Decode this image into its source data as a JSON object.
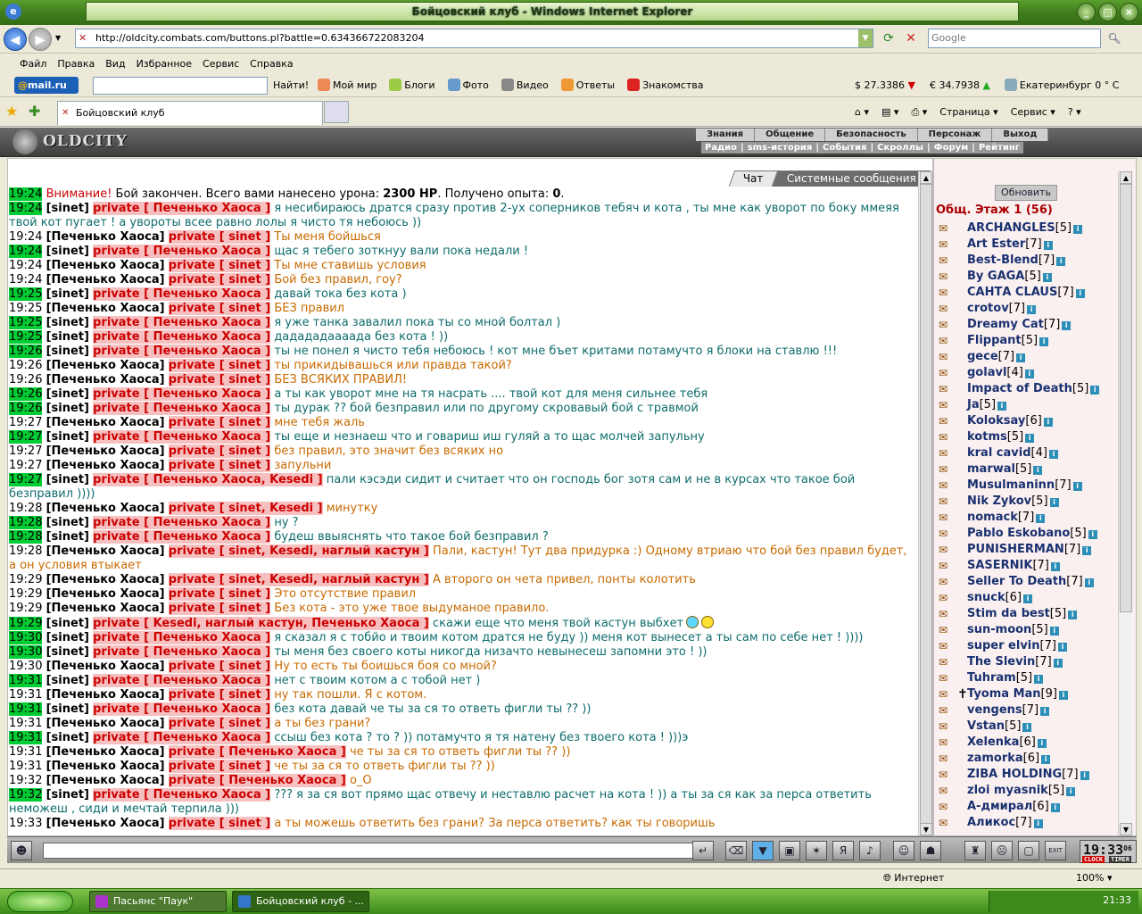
{
  "window": {
    "title": "Бойцовский клуб - Windows Internet Explorer"
  },
  "address": {
    "url": "http://oldcity.combats.com/buttons.pl?battle=0.634366722083204",
    "search_placeholder": "Google"
  },
  "menu": [
    "Файл",
    "Правка",
    "Вид",
    "Избранное",
    "Сервис",
    "Справка"
  ],
  "mailbar": {
    "logo": "mail.ru",
    "find": "Найти!",
    "links": [
      "Мой мир",
      "Блоги",
      "Фото",
      "Видео",
      "Ответы",
      "Знакомства"
    ],
    "usd": "$ 27.3386",
    "eur": "€ 34.7938",
    "weather": "Екатеринбург 0 ° C"
  },
  "tab": {
    "label": "Бойцовский клуб"
  },
  "ietools": {
    "page": "Страница",
    "service": "Сервис"
  },
  "game": {
    "logo": "OLDCITY",
    "topnav": [
      "Знания",
      "Общение",
      "Безопасность",
      "Персонаж",
      "Выход"
    ],
    "subnav": [
      "Радио",
      "sms-история",
      "События",
      "Скроллы",
      "Форум",
      "Рейтинг"
    ]
  },
  "chat": {
    "tabs": {
      "chat": "Чат",
      "system": "Системные сообщения"
    },
    "lines": [
      {
        "t": "19:24",
        "h": true,
        "a": "",
        "p": "",
        "m": "",
        "sys": true,
        "pre": "Внимание!",
        "body1": " Бой закончен. Всего вами нанесено урона: ",
        "b1": "2300 HP",
        "body2": ". Получено опыта: ",
        "b2": "0",
        "body3": "."
      },
      {
        "t": "19:24",
        "h": true,
        "a": "[sinet]",
        "p": "private [ Печенько Хаоса ]",
        "m": "я несибираюсь дратся сразу против 2-ух соперников тебяч и кота , ты мне как уворот по боку ммеяя твой кот пугает ! а увороты всее равно лолы я чисто тя небоюсь ))",
        "c": "teal"
      },
      {
        "t": "19:24",
        "h": false,
        "a": "[Печенько Хаоса]",
        "p": "private [ sinet ]",
        "m": "Ты меня бойшься",
        "c": "orange"
      },
      {
        "t": "19:24",
        "h": true,
        "a": "[sinet]",
        "p": "private [ Печенько Хаоса ]",
        "m": "щас я тебего зоткнуу вали пока недали !",
        "c": "teal"
      },
      {
        "t": "19:24",
        "h": false,
        "a": "[Печенько Хаоса]",
        "p": "private [ sinet ]",
        "m": "Ты мне ставишь условия",
        "c": "orange"
      },
      {
        "t": "19:24",
        "h": false,
        "a": "[Печенько Хаоса]",
        "p": "private [ sinet ]",
        "m": "Бой без правил, гоу?",
        "c": "orange"
      },
      {
        "t": "19:25",
        "h": true,
        "a": "[sinet]",
        "p": "private [ Печенько Хаоса ]",
        "m": "давай тока без кота )",
        "c": "teal"
      },
      {
        "t": "19:25",
        "h": false,
        "a": "[Печенько Хаоса]",
        "p": "private [ sinet ]",
        "m": "БЕЗ правил",
        "c": "orange"
      },
      {
        "t": "19:25",
        "h": true,
        "a": "[sinet]",
        "p": "private [ Печенько Хаоса ]",
        "m": "я уже танка завалил пока ты со мной болтал )",
        "c": "teal"
      },
      {
        "t": "19:25",
        "h": true,
        "a": "[sinet]",
        "p": "private [ Печенько Хаоса ]",
        "m": "дадададаааада без кота ! ))",
        "c": "teal"
      },
      {
        "t": "19:26",
        "h": true,
        "a": "[sinet]",
        "p": "private [ Печенько Хаоса ]",
        "m": "ты не понел я чисто тебя небоюсь ! кот мне бъет критами потамучто я блоки на ставлю !!!",
        "c": "teal"
      },
      {
        "t": "19:26",
        "h": false,
        "a": "[Печенько Хаоса]",
        "p": "private [ sinet ]",
        "m": "ты прикидывашься или правда такой?",
        "c": "orange"
      },
      {
        "t": "19:26",
        "h": false,
        "a": "[Печенько Хаоса]",
        "p": "private [ sinet ]",
        "m": "БЕЗ ВСЯКИХ ПРАВИЛ!",
        "c": "orange"
      },
      {
        "t": "19:26",
        "h": true,
        "a": "[sinet]",
        "p": "private [ Печенько Хаоса ]",
        "m": "а ты как уворот мне на тя насрать .... твой кот для меня сильнее тебя",
        "c": "teal"
      },
      {
        "t": "19:26",
        "h": true,
        "a": "[sinet]",
        "p": "private [ Печенько Хаоса ]",
        "m": "ты дурак ?? бой безправил или по другому скровавый бой с травмой",
        "c": "teal"
      },
      {
        "t": "19:27",
        "h": false,
        "a": "[Печенько Хаоса]",
        "p": "private [ sinet ]",
        "m": "мне тебя жаль",
        "c": "orange"
      },
      {
        "t": "19:27",
        "h": true,
        "a": "[sinet]",
        "p": "private [ Печенько Хаоса ]",
        "m": "ты еще и незнаеш что и говариш иш гуляй а то щас молчей запульну",
        "c": "teal"
      },
      {
        "t": "19:27",
        "h": false,
        "a": "[Печенько Хаоса]",
        "p": "private [ sinet ]",
        "m": "без правил, это значит без всяких но",
        "c": "orange"
      },
      {
        "t": "19:27",
        "h": false,
        "a": "[Печенько Хаоса]",
        "p": "private [ sinet ]",
        "m": "запульни",
        "c": "orange"
      },
      {
        "t": "19:27",
        "h": true,
        "a": "[sinet]",
        "p": "private [ Печенько Хаоса, Kesedi ]",
        "m": "пали кэсэди сидит и считает что он господь бог зотя сам и не в курсах что такое бой безправил ))))",
        "c": "teal"
      },
      {
        "t": "19:28",
        "h": false,
        "a": "[Печенько Хаоса]",
        "p": "private [ sinet, Kesedi ]",
        "m": "минутку",
        "c": "orange"
      },
      {
        "t": "19:28",
        "h": true,
        "a": "[sinet]",
        "p": "private [ Печенько Хаоса ]",
        "m": "ну ?",
        "c": "teal"
      },
      {
        "t": "19:28",
        "h": true,
        "a": "[sinet]",
        "p": "private [ Печенько Хаоса ]",
        "m": "будеш ввыяснять что такое бой безправил ?",
        "c": "teal"
      },
      {
        "t": "19:28",
        "h": false,
        "a": "[Печенько Хаоса]",
        "p": "private [ sinet, Kesedi, наглый кастун ]",
        "m": "Пали, кастун! Тут два придурка :) Одному втриаю что бой без правил будет, а он условия втыкает",
        "c": "orange"
      },
      {
        "t": "19:29",
        "h": false,
        "a": "[Печенько Хаоса]",
        "p": "private [ sinet, Kesedi, наглый кастун ]",
        "m": "А второго он чета привел, понты колотить",
        "c": "orange"
      },
      {
        "t": "19:29",
        "h": false,
        "a": "[Печенько Хаоса]",
        "p": "private [ sinet ]",
        "m": "Это отсутствие правил",
        "c": "orange"
      },
      {
        "t": "19:29",
        "h": false,
        "a": "[Печенько Хаоса]",
        "p": "private [ sinet ]",
        "m": "Без кота - это уже твое выдуманое правило.",
        "c": "orange"
      },
      {
        "t": "19:29",
        "h": true,
        "a": "[sinet]",
        "p": "private [ Kesedi, наглый кастун, Печенько Хаоса ]",
        "m": "скажи еще что меня твой кастун выбхет",
        "c": "teal",
        "smile": true
      },
      {
        "t": "19:30",
        "h": true,
        "a": "[sinet]",
        "p": "private [ Печенько Хаоса ]",
        "m": "я сказал я с тобйо и твоим котом дратся не буду )) меня кот вынесет а ты сам по себе нет ! ))))",
        "c": "teal"
      },
      {
        "t": "19:30",
        "h": true,
        "a": "[sinet]",
        "p": "private [ Печенько Хаоса ]",
        "m": "ты меня без своего коты никогда низачто невынесеш запомни это ! ))",
        "c": "teal"
      },
      {
        "t": "19:30",
        "h": false,
        "a": "[Печенько Хаоса]",
        "p": "private [ sinet ]",
        "m": "Ну то есть ты боишься боя со мной?",
        "c": "orange"
      },
      {
        "t": "19:31",
        "h": true,
        "a": "[sinet]",
        "p": "private [ Печенько Хаоса ]",
        "m": "нет с твоим котом а с тобой нет )",
        "c": "teal"
      },
      {
        "t": "19:31",
        "h": false,
        "a": "[Печенько Хаоса]",
        "p": "private [ sinet ]",
        "m": "ну так пошли. Я с котом.",
        "c": "orange"
      },
      {
        "t": "19:31",
        "h": true,
        "a": "[sinet]",
        "p": "private [ Печенько Хаоса ]",
        "m": "без кота давай че ты за ся то ответь фигли ты ?? ))",
        "c": "teal"
      },
      {
        "t": "19:31",
        "h": false,
        "a": "[Печенько Хаоса]",
        "p": "private [ sinet ]",
        "m": "а ты без грани?",
        "c": "orange"
      },
      {
        "t": "19:31",
        "h": true,
        "a": "[sinet]",
        "p": "private [ Печенько Хаоса ]",
        "m": "ссыш без кота ? то ? )) потамучто я тя натену без твоего кота ! )))э",
        "c": "teal"
      },
      {
        "t": "19:31",
        "h": false,
        "a": "[Печенько Хаоса]",
        "p": "private [ Печенько Хаоса ]",
        "m": "че ты за ся то ответь фигли ты ?? ))",
        "c": "orange"
      },
      {
        "t": "19:31",
        "h": false,
        "a": "[Печенько Хаоса]",
        "p": "private [ sinet ]",
        "m": "че ты за ся то ответь фигли ты ?? ))",
        "c": "orange"
      },
      {
        "t": "19:32",
        "h": false,
        "a": "[Печенько Хаоса]",
        "p": "private [ Печенько Хаоса ]",
        "m": "о_О",
        "c": "orange"
      },
      {
        "t": "19:32",
        "h": true,
        "a": "[sinet]",
        "p": "private [ Печенько Хаоса ]",
        "m": "??? я за ся вот прямо щас отвечу и неставлю расчет на кота ! )) а ты за ся как за перса ответить неможеш , сиди и мечтай терпила )))",
        "c": "teal"
      },
      {
        "t": "19:33",
        "h": false,
        "a": "[Печенько Хаоса]",
        "p": "private [ sinet ]",
        "m": "а ты можешь ответить без грани? За перса ответить? как ты говоришь",
        "c": "orange"
      }
    ]
  },
  "room": {
    "refresh": "Обновить",
    "title": "Общ. Этаж 1 (56)",
    "users": [
      {
        "n": "ARCHANGLES",
        "l": "[5]"
      },
      {
        "n": "Art Ester",
        "l": "[7]"
      },
      {
        "n": "Best-Blend",
        "l": "[7]"
      },
      {
        "n": "By GAGA",
        "l": "[5]"
      },
      {
        "n": "САНТА CLAUS",
        "l": "[7]"
      },
      {
        "n": "crotov",
        "l": "[7]"
      },
      {
        "n": "Dreamy Cat",
        "l": "[7]"
      },
      {
        "n": "Flippant",
        "l": "[5]"
      },
      {
        "n": "gece",
        "l": "[7]"
      },
      {
        "n": "golavl",
        "l": "[4]"
      },
      {
        "n": "Impact of Death",
        "l": "[5]"
      },
      {
        "n": "Ja",
        "l": "[5]"
      },
      {
        "n": "Koloksay",
        "l": "[6]"
      },
      {
        "n": "kotms",
        "l": "[5]"
      },
      {
        "n": "kral cavid",
        "l": "[4]"
      },
      {
        "n": "marwal",
        "l": "[5]"
      },
      {
        "n": "Musulmaninn",
        "l": "[7]"
      },
      {
        "n": "Nik Zykov",
        "l": "[5]"
      },
      {
        "n": "nomack",
        "l": "[7]"
      },
      {
        "n": "Pablo Eskobano",
        "l": "[5]"
      },
      {
        "n": "PUNISHERMAN",
        "l": "[7]"
      },
      {
        "n": "SASERNIK",
        "l": "[7]"
      },
      {
        "n": "Seller To Death",
        "l": "[7]"
      },
      {
        "n": "snuck",
        "l": "[6]"
      },
      {
        "n": "Stim da best",
        "l": "[5]"
      },
      {
        "n": "sun-moon",
        "l": "[5]"
      },
      {
        "n": "super elvin",
        "l": "[7]"
      },
      {
        "n": "The Slevin",
        "l": "[7]"
      },
      {
        "n": "Tuhram",
        "l": "[5]"
      },
      {
        "n": "Tyoma Man",
        "l": "[9]"
      },
      {
        "n": "vengens",
        "l": "[7]"
      },
      {
        "n": "Vstan",
        "l": "[5]"
      },
      {
        "n": "Xelenka",
        "l": "[6]"
      },
      {
        "n": "zamorka",
        "l": "[6]"
      },
      {
        "n": "ZIBA HOLDING",
        "l": "[7]"
      },
      {
        "n": "zloi myasnik",
        "l": "[5]"
      },
      {
        "n": "А-дмирал",
        "l": "[6]"
      },
      {
        "n": "Аликос",
        "l": "[7]"
      }
    ]
  },
  "clock": {
    "time": "19:33",
    "sec": "06",
    "clock_label": "CLOCK",
    "timer_label": "TIMER"
  },
  "status": {
    "zone": "Интернет",
    "zoom": "100%"
  },
  "taskbar": {
    "task1": "Пасьянс \"Паук\"",
    "task2": "Бойцовский клуб - ...",
    "time": "21:33"
  },
  "colors": {
    "private_red": "#cc0000",
    "timestamp_green": "#00cc33",
    "teal": "#0f6c6c",
    "orange": "#c86a00"
  }
}
